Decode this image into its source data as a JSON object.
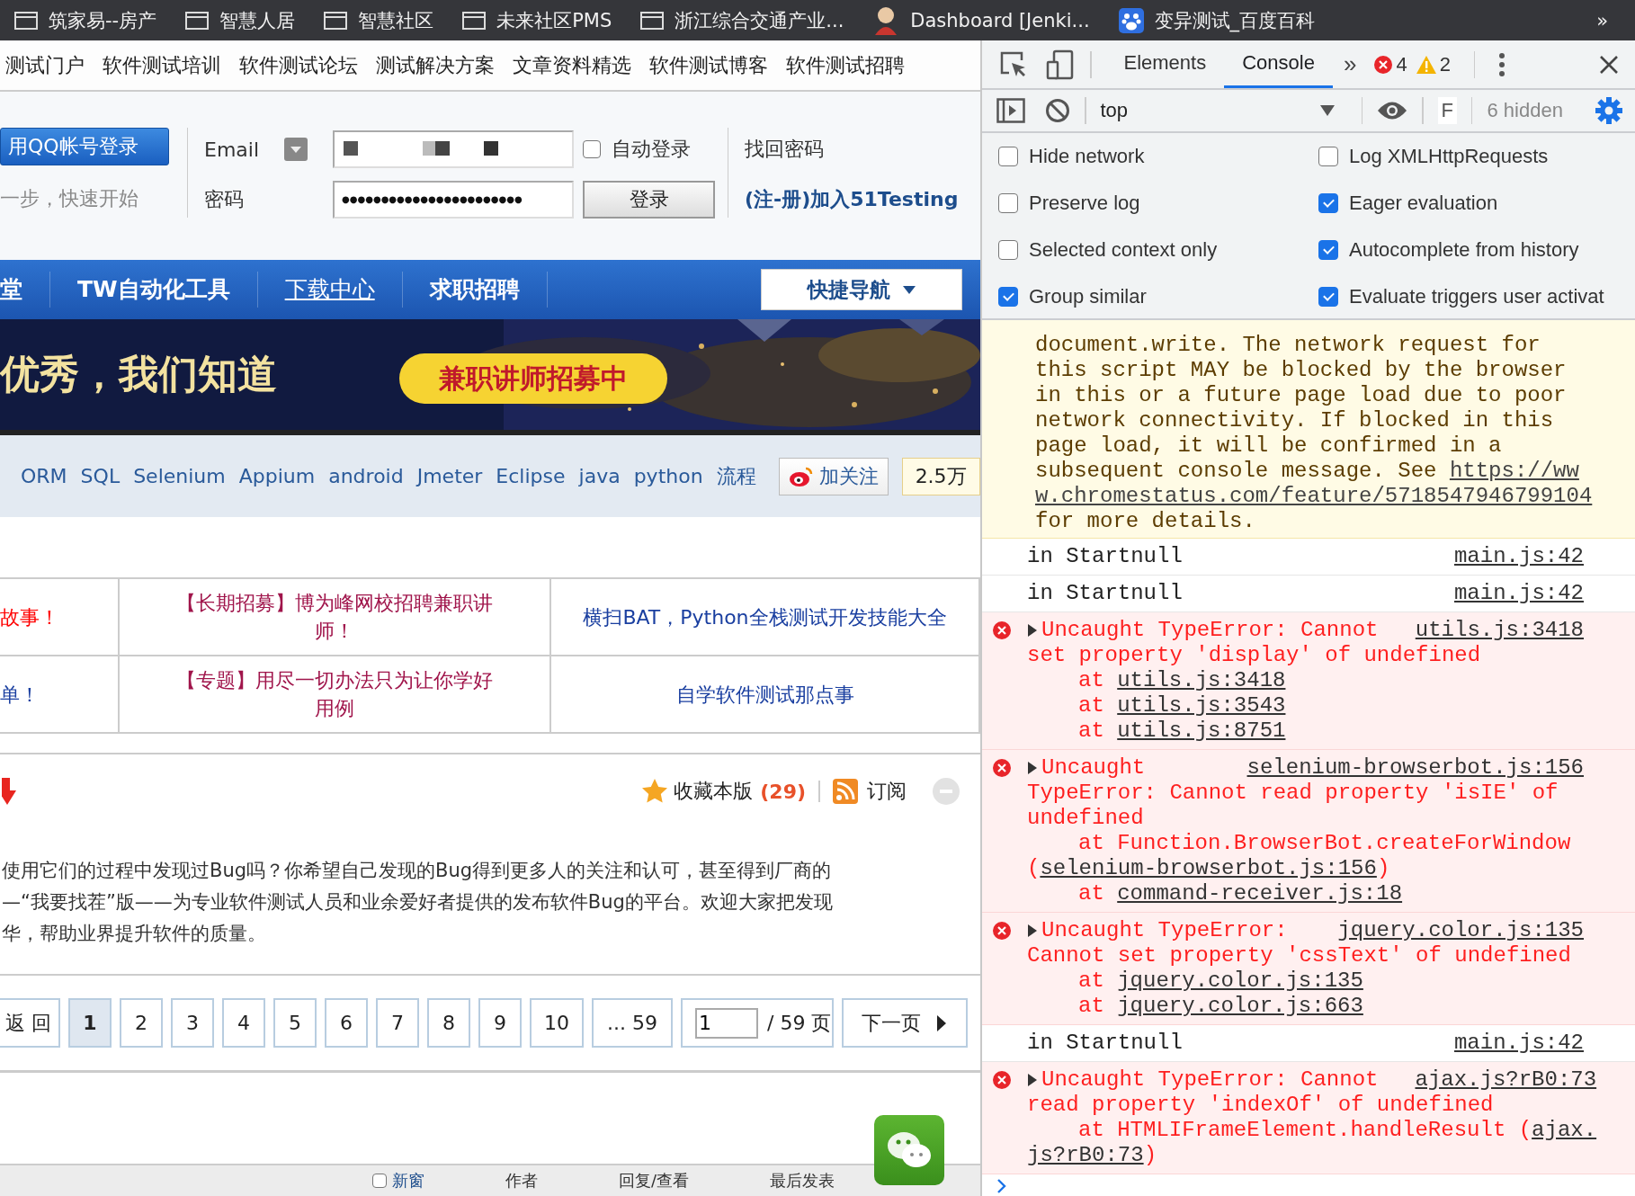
{
  "bookmarks_bar": {
    "items": [
      {
        "kind": "folder",
        "label": "筑家易--房产"
      },
      {
        "kind": "folder",
        "label": "智慧人居"
      },
      {
        "kind": "folder",
        "label": "智慧社区"
      },
      {
        "kind": "folder",
        "label": "未来社区PMS"
      },
      {
        "kind": "folder",
        "label": "浙江综合交通产业..."
      },
      {
        "kind": "figure",
        "label": "Dashboard [Jenki..."
      },
      {
        "kind": "paw",
        "label": "变异测试_百度百科"
      }
    ],
    "overflow": "»"
  },
  "page": {
    "top_links": [
      "测试门户",
      "软件测试培训",
      "软件测试论坛",
      "测试解决方案",
      "文章资料精选",
      "软件测试博客",
      "软件测试招聘"
    ],
    "login": {
      "qq_button": "用QQ帐号登录",
      "qq_hint": "一步，快速开始",
      "email_label": "Email",
      "password_label": "密码",
      "password_value": "●●●●●●●●●●●●●●●●●●●●●●●",
      "auto_login": {
        "label": "自动登录",
        "checked": false
      },
      "login_button": "登录",
      "forgot_link": "找回密码",
      "register_link": "(注-册)加入51Testing"
    },
    "nav": {
      "items": [
        {
          "label": "堂",
          "underlined": false
        },
        {
          "label": "TW自动化工具",
          "underlined": false
        },
        {
          "label": "下载中心",
          "underlined": true
        },
        {
          "label": "求职招聘",
          "underlined": false
        }
      ],
      "quick_nav": "快捷导航"
    },
    "banner": {
      "headline": "优秀，我们知道",
      "badge": "兼职讲师招募中"
    },
    "tags": {
      "items": [
        "ORM",
        "SQL",
        "Selenium",
        "Appium",
        "android",
        "Jmeter",
        "Eclipse",
        "java",
        "python",
        "流程"
      ],
      "follow_button": "加关注",
      "follower_count": "2.5万"
    },
    "table": {
      "rows": [
        [
          {
            "text": "故事！",
            "color": "#ff0000"
          },
          {
            "text": "【长期招募】博为峰网校招聘兼职讲师！",
            "color": "#a0154b"
          },
          {
            "text": "横扫BAT，Python全栈测试开发技能大全",
            "color": "#1a3fa0"
          }
        ],
        [
          {
            "text": "单！",
            "color": "#1a3fa0"
          },
          {
            "text": "【专题】用尽一切办法只为让你学好用例",
            "color": "#a0154b"
          },
          {
            "text": "自学软件测试那点事",
            "color": "#1a3fa0"
          }
        ]
      ]
    },
    "forum": {
      "favorite_label": "收藏本版",
      "favorite_count": "(29)",
      "subscribe_label": "订阅",
      "description_lines": [
        "使用它们的过程中发现过Bug吗？你希望自己发现的Bug得到更多人的关注和认可，甚至得到厂商的",
        "—“我要找茬”版——为专业软件测试人员和业余爱好者提供的发布软件Bug的平台。欢迎大家把发现",
        "华，帮助业界提升软件的质量。"
      ]
    },
    "pagination": {
      "back": "返 回",
      "pages": [
        {
          "label": "1",
          "selected": true
        },
        {
          "label": "2",
          "selected": false
        },
        {
          "label": "3",
          "selected": false
        },
        {
          "label": "4",
          "selected": false
        },
        {
          "label": "5",
          "selected": false
        },
        {
          "label": "6",
          "selected": false
        },
        {
          "label": "7",
          "selected": false
        },
        {
          "label": "8",
          "selected": false
        },
        {
          "label": "9",
          "selected": false
        },
        {
          "label": "10",
          "selected": false
        }
      ],
      "last": "... 59",
      "page_input": "1",
      "page_total": "/ 59 页",
      "next": "下一页"
    },
    "thread_header": {
      "new_window": {
        "label": "新窗",
        "checked": false
      },
      "columns": [
        "作者",
        "回复/查看",
        "最后发表"
      ]
    }
  },
  "devtools": {
    "tabs": [
      {
        "label": "Elements",
        "selected": false
      },
      {
        "label": "Console",
        "selected": true
      }
    ],
    "more_tabs": "»",
    "error_count": "4",
    "warning_count": "2",
    "context": "top",
    "filter_placeholder": "F",
    "hidden_count": "6 hidden",
    "settings": [
      {
        "label": "Hide network",
        "checked": false
      },
      {
        "label": "Log XMLHttpRequests",
        "checked": false
      },
      {
        "label": "Preserve log",
        "checked": false
      },
      {
        "label": "Eager evaluation",
        "checked": true
      },
      {
        "label": "Selected context only",
        "checked": false
      },
      {
        "label": "Autocomplete from history",
        "checked": true
      },
      {
        "label": "Group similar",
        "checked": true
      },
      {
        "label": "Evaluate triggers user activat",
        "checked": true
      }
    ],
    "messages": [
      {
        "kind": "warning",
        "text": "document.write. The network request for\nthis script MAY be blocked by the browser\nin this or a future page load due to poor\nnetwork connectivity. If blocked in this\npage load, it will be confirmed in a\nsubsequent console message. See ",
        "link": [
          "https://ww",
          "w.chromestatus.com/feature/5718547946799104"
        ],
        "after": "\nfor more details."
      },
      {
        "kind": "log",
        "text": "in Startnull",
        "source": "main.js:42"
      },
      {
        "kind": "log",
        "text": "in Startnull",
        "source": "main.js:42"
      },
      {
        "kind": "error",
        "lines": [
          "Uncaught TypeError: Cannot",
          "set property 'display' of undefined"
        ],
        "source": "utils.js:3418",
        "stack": [
          {
            "kind": "frame",
            "text": "at ",
            "link": [
              "utils.js:3418"
            ]
          },
          {
            "kind": "frame",
            "text": "at ",
            "link": [
              "utils.js:3543"
            ]
          },
          {
            "kind": "frame",
            "text": "at ",
            "link": [
              "utils.js:8751"
            ]
          }
        ]
      },
      {
        "kind": "error",
        "lines": [
          "Uncaught",
          "TypeError: Cannot read property 'isIE' of",
          "undefined"
        ],
        "source": "selenium-browserbot.js:156",
        "stack": [
          {
            "kind": "frame",
            "text": "at Function.BrowserBot.createForWindow"
          },
          {
            "kind": "continuation",
            "text": "(",
            "link": [
              "selenium-browserbot.js:156"
            ],
            "after": ")"
          },
          {
            "kind": "frame",
            "text": "at ",
            "link": [
              "command-receiver.js:18"
            ]
          }
        ]
      },
      {
        "kind": "error",
        "lines": [
          "Uncaught TypeError:",
          "Cannot set property 'cssText' of undefined"
        ],
        "source": "jquery.color.js:135",
        "stack": [
          {
            "kind": "frame",
            "text": "at ",
            "link": [
              "jquery.color.js:135"
            ]
          },
          {
            "kind": "frame",
            "text": "at ",
            "link": [
              "jquery.color.js:663"
            ]
          }
        ]
      },
      {
        "kind": "log",
        "text": "in Startnull",
        "source": "main.js:42"
      },
      {
        "kind": "error",
        "lines": [
          "Uncaught TypeError: Cannot",
          "read property 'indexOf' of undefined"
        ],
        "source": "ajax.js?rB0:73",
        "stack": [
          {
            "kind": "frame",
            "text": "at HTMLIFrameElement.handleResult (",
            "link": [
              "ajax.",
              "js?rB0:73"
            ],
            "after": ")"
          }
        ]
      }
    ]
  }
}
